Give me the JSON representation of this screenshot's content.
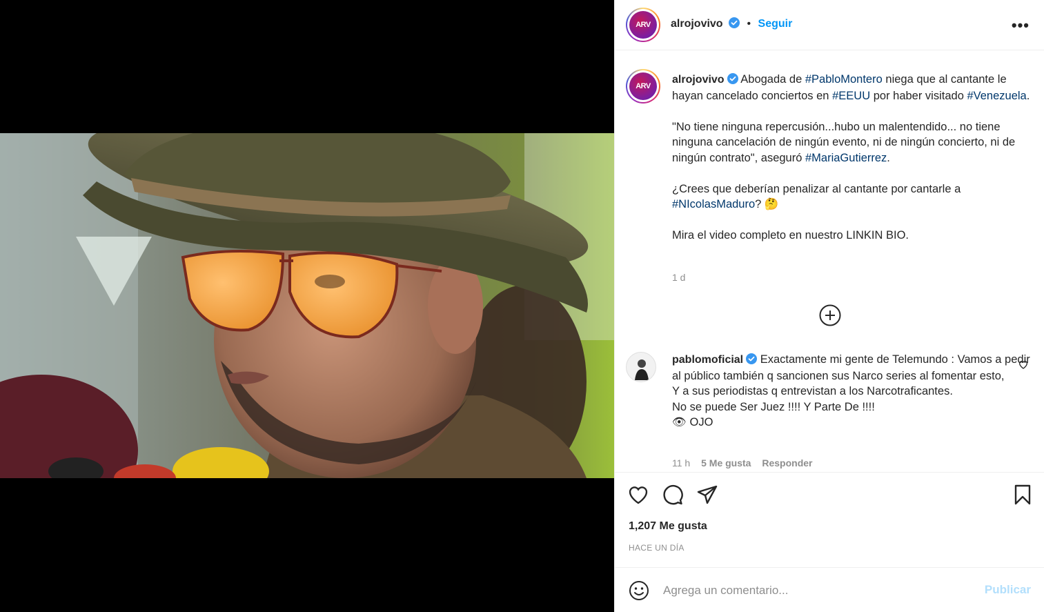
{
  "header": {
    "avatar_text": "ARV",
    "username": "alrojovivo",
    "separator": "•",
    "follow_label": "Seguir",
    "more_label": "•••"
  },
  "caption": {
    "username": "alrojovivo",
    "p1_before": "Abogada de",
    "p1_tag1": "#PabloMontero",
    "p1_mid": "niega que al cantante le hayan cancelado conciertos en",
    "p1_tag2": "#EEUU",
    "p1_after": "por haber visitado",
    "p1_tag3": "#Venezuela",
    "p1_end": ".",
    "p2_text": "\"No tiene ninguna repercusión...hubo un malentendido... no tiene ninguna cancelación de ningún evento, ni de ningún concierto, ni de ningún contrato\", aseguró",
    "p2_tag": "#MariaGutierrez",
    "p2_end": ".",
    "p3_text": "¿Crees que deberían penalizar al cantante por cantarle a",
    "p3_tag": "#NIcolasMaduro",
    "p3_end": "? 🤔",
    "p4_text": "Mira el video completo en nuestro LINKIN BIO.",
    "time": "1 d"
  },
  "comment": {
    "username": "pablomoficial",
    "line1": "Exactamente mi gente de Telemundo : Vamos a pedir al público también q sancionen sus Narco series al fomentar esto,",
    "line2": "Y a sus periodistas q entrevistan a los Narcotraficantes.",
    "line3": "No se puede Ser Juez !!!! Y Parte De !!!!",
    "line4": "👁 OJO",
    "time": "11 h",
    "likes": "5 Me gusta",
    "reply": "Responder"
  },
  "actions": {
    "likes": "1,207 Me gusta",
    "posted": "HACE UN DÍA"
  },
  "comment_box": {
    "placeholder": "Agrega un comentario...",
    "publish_label": "Publicar"
  },
  "colors": {
    "accent": "#0095f6",
    "hashtag": "#00376b",
    "muted": "#8e8e8e",
    "verified": "#3897f0"
  }
}
